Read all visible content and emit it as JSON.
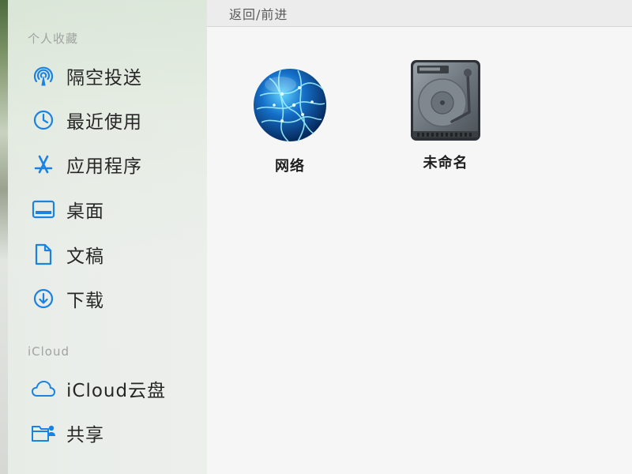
{
  "toolbar": {
    "nav_label": "返回/前进"
  },
  "sidebar": {
    "favorites_header": "个人收藏",
    "favorites": [
      {
        "label": "隔空投送",
        "icon": "airdrop-icon"
      },
      {
        "label": "最近使用",
        "icon": "clock-icon"
      },
      {
        "label": "应用程序",
        "icon": "applications-icon"
      },
      {
        "label": "桌面",
        "icon": "desktop-icon"
      },
      {
        "label": "文稿",
        "icon": "document-icon"
      },
      {
        "label": "下载",
        "icon": "download-icon"
      }
    ],
    "icloud_header": "iCloud",
    "icloud": [
      {
        "label": "iCloud云盘",
        "icon": "cloud-icon"
      },
      {
        "label": "共享",
        "icon": "shared-folder-icon"
      }
    ]
  },
  "files": [
    {
      "label": "网络",
      "icon": "network-globe-icon"
    },
    {
      "label": "未命名",
      "icon": "hard-drive-icon"
    }
  ],
  "colors": {
    "accent": "#1a82e2",
    "sidebar_text": "#262626",
    "section_header": "#a0a3a0"
  }
}
